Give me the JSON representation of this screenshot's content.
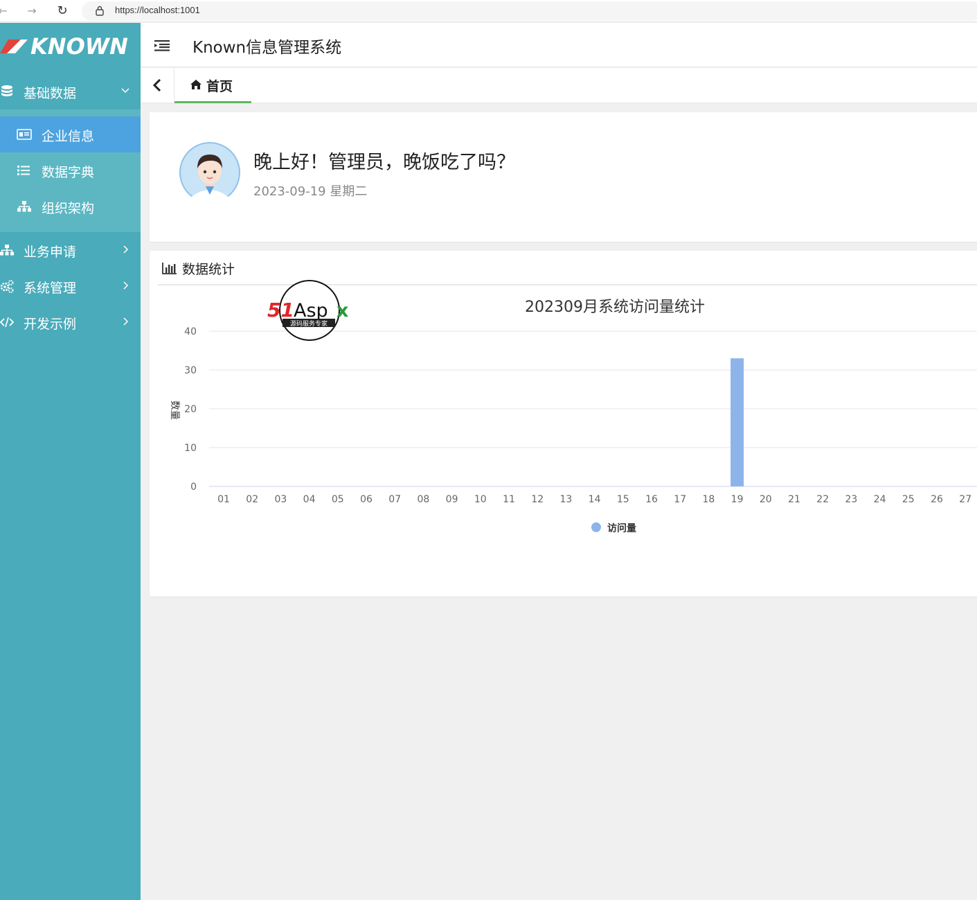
{
  "browser": {
    "url": "https://localhost:1001"
  },
  "sidebar": {
    "logo_text": "KNOWN",
    "menus": [
      {
        "label": "基础数据",
        "icon": "database-icon",
        "expanded": true
      },
      {
        "label": "业务申请",
        "icon": "sitemap-icon",
        "expanded": false
      },
      {
        "label": "系统管理",
        "icon": "cogs-icon",
        "expanded": false
      },
      {
        "label": "开发示例",
        "icon": "code-icon",
        "expanded": false
      }
    ],
    "submenu": [
      {
        "label": "企业信息",
        "icon": "id-card-icon",
        "active": true
      },
      {
        "label": "数据字典",
        "icon": "list-icon",
        "active": false
      },
      {
        "label": "组织架构",
        "icon": "sitemap-icon",
        "active": false
      }
    ]
  },
  "header": {
    "title": "Known信息管理系统"
  },
  "tabs": {
    "home_label": "首页"
  },
  "welcome": {
    "greeting": "晚上好！管理员，晚饭吃了吗？",
    "date": "2023-09-19 星期二"
  },
  "stats": {
    "title": "数据统计",
    "watermark_brand": "51Aspx",
    "watermark_sub": "源码服务专家"
  },
  "colors": {
    "sidebar": "#4aabba",
    "submenu": "#5cb7c3",
    "active_item": "#4da3e0",
    "bar": "#8cb4ea",
    "tab_underline": "#5cb85c"
  },
  "chart_data": {
    "type": "bar",
    "title": "202309月系统访问量统计",
    "xlabel": "",
    "ylabel": "数量",
    "ylim": [
      0,
      40
    ],
    "yticks": [
      0,
      10,
      20,
      30,
      40
    ],
    "categories": [
      "01",
      "02",
      "03",
      "04",
      "05",
      "06",
      "07",
      "08",
      "09",
      "10",
      "11",
      "12",
      "13",
      "14",
      "15",
      "16",
      "17",
      "18",
      "19",
      "20",
      "21",
      "22",
      "23",
      "24",
      "25",
      "26",
      "27"
    ],
    "series": [
      {
        "name": "访问量",
        "values": [
          0,
          0,
          0,
          0,
          0,
          0,
          0,
          0,
          0,
          0,
          0,
          0,
          0,
          0,
          0,
          0,
          0,
          0,
          33,
          0,
          0,
          0,
          0,
          0,
          0,
          0,
          0
        ]
      }
    ],
    "legend": "bottom-center",
    "grid": true
  }
}
